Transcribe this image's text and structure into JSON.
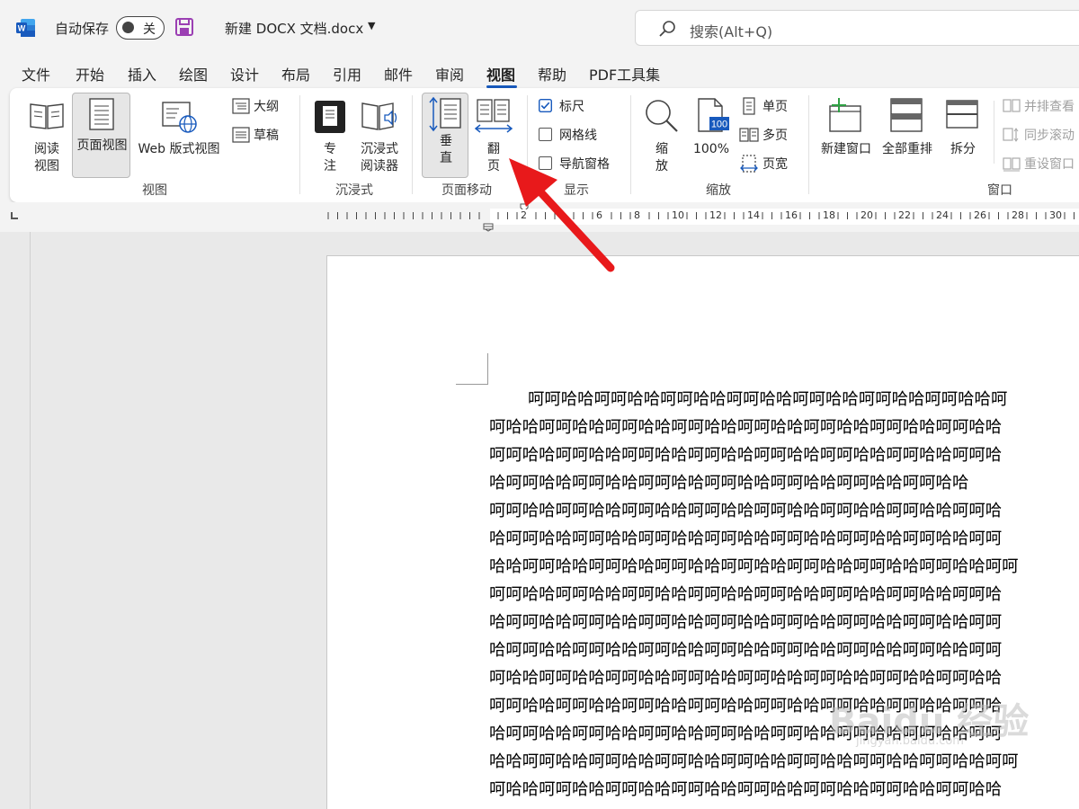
{
  "titlebar": {
    "autosave_label": "自动保存",
    "autosave_state": "关",
    "doc_title": "新建 DOCX 文档.docx",
    "search_placeholder": "搜索(Alt+Q)"
  },
  "tabs": [
    {
      "label": "文件"
    },
    {
      "label": "开始"
    },
    {
      "label": "插入"
    },
    {
      "label": "绘图"
    },
    {
      "label": "设计"
    },
    {
      "label": "布局"
    },
    {
      "label": "引用"
    },
    {
      "label": "邮件"
    },
    {
      "label": "审阅"
    },
    {
      "label": "视图",
      "active": true
    },
    {
      "label": "帮助"
    },
    {
      "label": "PDF工具集"
    }
  ],
  "ribbon": {
    "views": {
      "read_l1": "阅读",
      "read_l2": "视图",
      "print": "页面视图",
      "web": "Web 版式视图",
      "outline": "大纲",
      "draft": "草稿",
      "group": "视图"
    },
    "immersive": {
      "focus_l1": "专",
      "focus_l2": "注",
      "reader_l1": "沉浸式",
      "reader_l2": "阅读器",
      "group": "沉浸式"
    },
    "page_movement": {
      "vertical_l1": "垂",
      "vertical_l2": "直",
      "side_l1": "翻",
      "side_l2": "页",
      "group": "页面移动"
    },
    "show": {
      "ruler": "标尺",
      "ruler_checked": true,
      "gridlines": "网格线",
      "gridlines_checked": false,
      "nav_pane": "导航窗格",
      "nav_pane_checked": false,
      "group": "显示"
    },
    "zoom": {
      "zoom_l1": "缩",
      "zoom_l2": "放",
      "hundred": "100%",
      "hundred_icon": "100",
      "one_page": "单页",
      "multi_page": "多页",
      "page_width": "页宽",
      "group": "缩放"
    },
    "window": {
      "new_window": "新建窗口",
      "arrange_all": "全部重排",
      "split": "拆分",
      "side_by_side": "并排查看",
      "sync_scroll": "同步滚动",
      "reset_pos": "重设窗口",
      "group": "窗口"
    }
  },
  "ruler": {
    "numbers": [
      "2",
      "2",
      "4",
      "6",
      "8",
      "10",
      "12",
      "14",
      "16",
      "18",
      "20",
      "22",
      "24",
      "26",
      "28",
      "30"
    ]
  },
  "document": {
    "lines": [
      "呵呵哈哈呵呵哈哈呵呵哈哈呵呵哈哈呵呵哈哈呵呵哈哈呵呵哈哈呵",
      "呵哈哈呵呵哈哈呵呵哈哈呵呵哈哈呵呵哈哈呵呵哈哈呵呵哈哈呵呵哈哈",
      "呵呵哈哈呵呵哈哈呵呵哈哈呵呵哈哈呵呵哈哈呵呵哈哈呵呵哈哈呵呵哈",
      "哈呵呵哈哈呵呵哈哈呵呵哈哈呵呵哈哈呵呵哈哈呵呵哈哈呵呵哈哈",
      "呵呵哈哈呵呵哈哈呵呵哈哈呵呵哈哈呵呵哈哈呵呵哈哈呵呵哈哈呵呵哈",
      "哈呵呵哈哈呵呵哈哈呵呵哈哈呵呵哈哈呵呵哈哈呵呵哈哈呵呵哈哈呵呵",
      "哈哈呵呵哈哈呵呵哈哈呵呵哈哈呵呵哈哈呵呵哈哈呵呵哈哈呵呵哈哈呵呵",
      "呵呵哈哈呵呵哈哈呵呵哈哈呵呵哈哈呵呵哈哈呵呵哈哈呵呵哈哈呵呵哈",
      "哈呵呵哈哈呵呵哈哈呵呵哈哈呵呵哈哈呵呵哈哈呵呵哈哈呵呵哈哈呵呵",
      "哈呵呵哈哈呵呵哈哈呵呵哈哈呵呵哈哈呵呵哈哈呵呵哈哈呵呵哈哈呵呵",
      "呵哈哈呵呵哈哈呵呵哈哈呵呵哈哈呵呵哈哈呵呵哈哈呵呵哈哈呵呵哈哈",
      "呵呵哈哈呵呵哈哈呵呵哈哈呵呵哈哈呵呵哈哈呵呵哈哈呵呵哈哈呵呵哈",
      "哈呵呵哈哈呵呵哈哈呵呵哈哈呵呵哈哈呵呵哈哈呵呵哈哈呵呵哈哈呵呵",
      "哈哈呵呵哈哈呵呵哈哈呵呵哈哈呵呵哈哈呵呵哈哈呵呵哈哈呵呵哈哈呵呵",
      "呵哈哈呵呵哈哈呵呵哈哈呵呵哈哈呵呵哈哈呵呵哈哈呵呵哈哈呵呵哈哈"
    ]
  },
  "watermark": {
    "main": "Baidu 经验",
    "sub": "jingyan.baidu.com"
  },
  "colors": {
    "accent": "#185abd",
    "arrow": "#e8191b",
    "word_blue": "#185abd",
    "save_purple": "#9b3fb3"
  }
}
